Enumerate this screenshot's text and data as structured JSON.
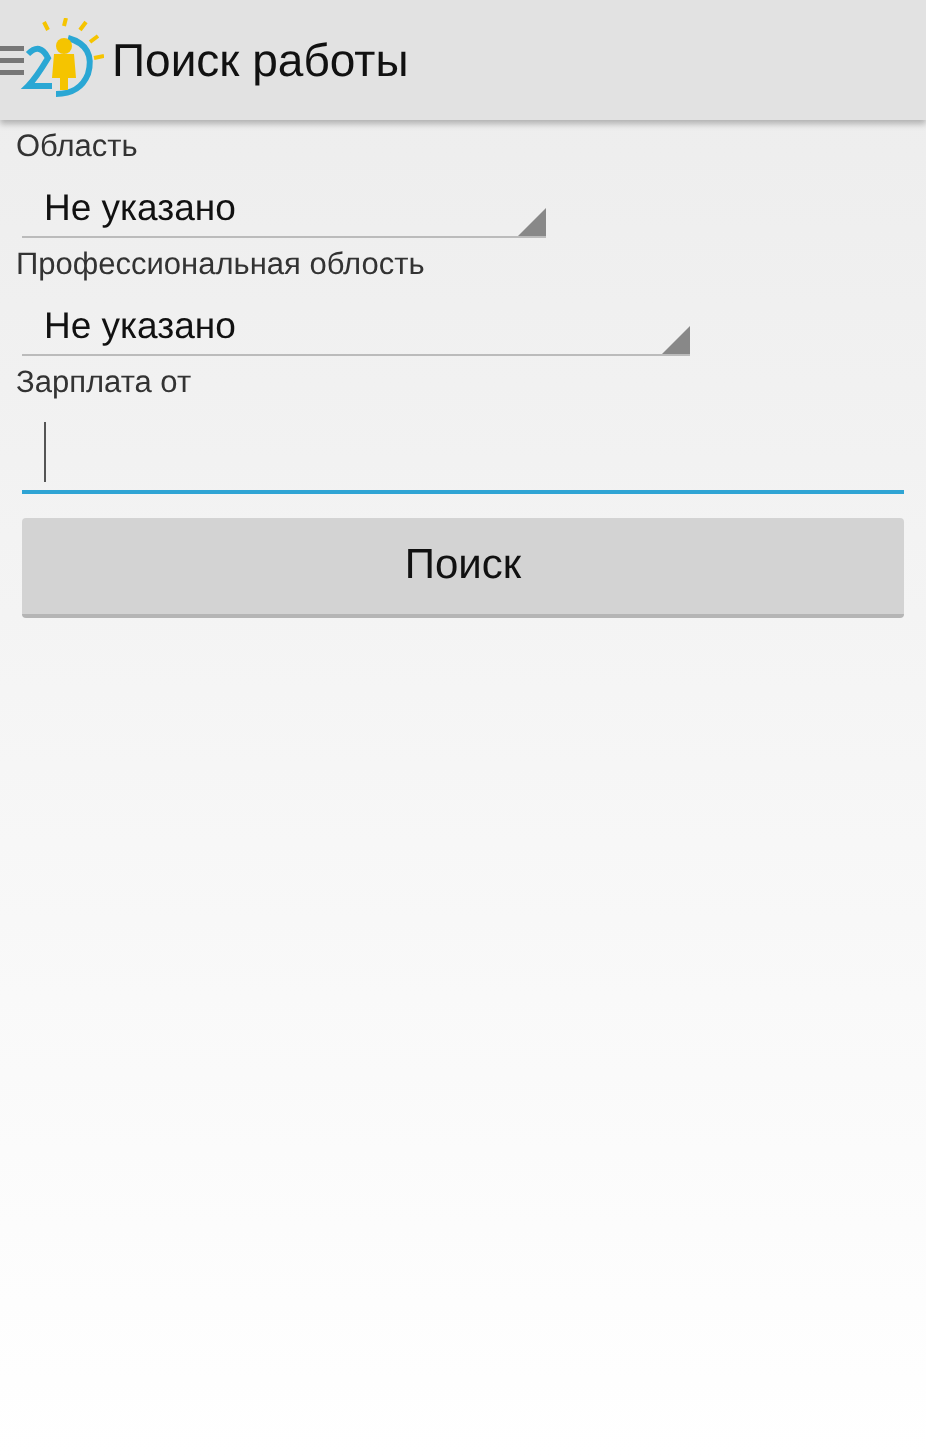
{
  "app_bar": {
    "title": "Поиск работы"
  },
  "fields": [
    {
      "kind": "spinner",
      "label": "Область",
      "value": "Не указано"
    },
    {
      "kind": "spinner",
      "label": "Профессиональная облость",
      "value": "Не указано"
    },
    {
      "kind": "text",
      "label": "Зарплата от",
      "focused": true
    }
  ],
  "buttons": [
    "Поиск"
  ]
}
